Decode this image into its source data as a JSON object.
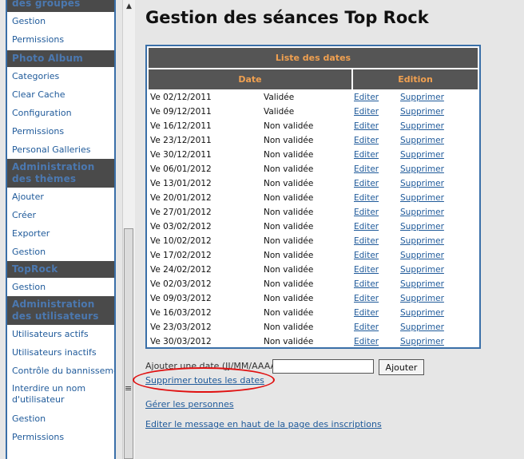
{
  "sidebar": {
    "top_head": "des groupes",
    "groups_items": [
      "Gestion",
      "Permissions"
    ],
    "photo_album": {
      "title": "Photo Album",
      "items": [
        "Categories",
        "Clear Cache",
        "Configuration",
        "Permissions",
        "Personal Galleries"
      ]
    },
    "themes": {
      "title": "Administration des thèmes",
      "items": [
        "Ajouter",
        "Créer",
        "Exporter",
        "Gestion"
      ]
    },
    "toprock": {
      "title": "TopRock",
      "items": [
        "Gestion"
      ]
    },
    "users": {
      "title": "Administration des utilisateurs",
      "items": [
        "Utilisateurs actifs",
        "Utilisateurs inactifs",
        "Contrôle du bannissement",
        "Interdire un nom d'utilisateur",
        "Gestion",
        "Permissions"
      ]
    }
  },
  "main": {
    "title": "Gestion des séances Top Rock",
    "table": {
      "caption": "Liste des dates",
      "col_date": "Date",
      "col_edition": "Edition",
      "edit_label": "Editer",
      "delete_label": "Supprimer",
      "rows": [
        {
          "date": "Ve 02/12/2011",
          "status": "Validée"
        },
        {
          "date": "Ve 09/12/2011",
          "status": "Validée"
        },
        {
          "date": "Ve 16/12/2011",
          "status": "Non validée"
        },
        {
          "date": "Ve 23/12/2011",
          "status": "Non validée"
        },
        {
          "date": "Ve 30/12/2011",
          "status": "Non validée"
        },
        {
          "date": "Ve 06/01/2012",
          "status": "Non validée"
        },
        {
          "date": "Ve 13/01/2012",
          "status": "Non validée"
        },
        {
          "date": "Ve 20/01/2012",
          "status": "Non validée"
        },
        {
          "date": "Ve 27/01/2012",
          "status": "Non validée"
        },
        {
          "date": "Ve 03/02/2012",
          "status": "Non validée"
        },
        {
          "date": "Ve 10/02/2012",
          "status": "Non validée"
        },
        {
          "date": "Ve 17/02/2012",
          "status": "Non validée"
        },
        {
          "date": "Ve 24/02/2012",
          "status": "Non validée"
        },
        {
          "date": "Ve 02/03/2012",
          "status": "Non validée"
        },
        {
          "date": "Ve 09/03/2012",
          "status": "Non validée"
        },
        {
          "date": "Ve 16/03/2012",
          "status": "Non validée"
        },
        {
          "date": "Ve 23/03/2012",
          "status": "Non validée"
        },
        {
          "date": "Ve 30/03/2012",
          "status": "Non validée"
        }
      ]
    },
    "add_date_label": "Ajouter une date (JJ/MM/AAAA)",
    "add_date_value": "",
    "add_button": "Ajouter",
    "delete_all_link": "Supprimer toutes les dates",
    "manage_people_link": "Gérer les personnes",
    "edit_message_link": "Editer le message en haut de la page des inscriptions"
  },
  "colors": {
    "accent_link": "#1f5a9a",
    "header_bg": "#555555",
    "header_text": "#f0a050",
    "annotation": "#e01010"
  }
}
